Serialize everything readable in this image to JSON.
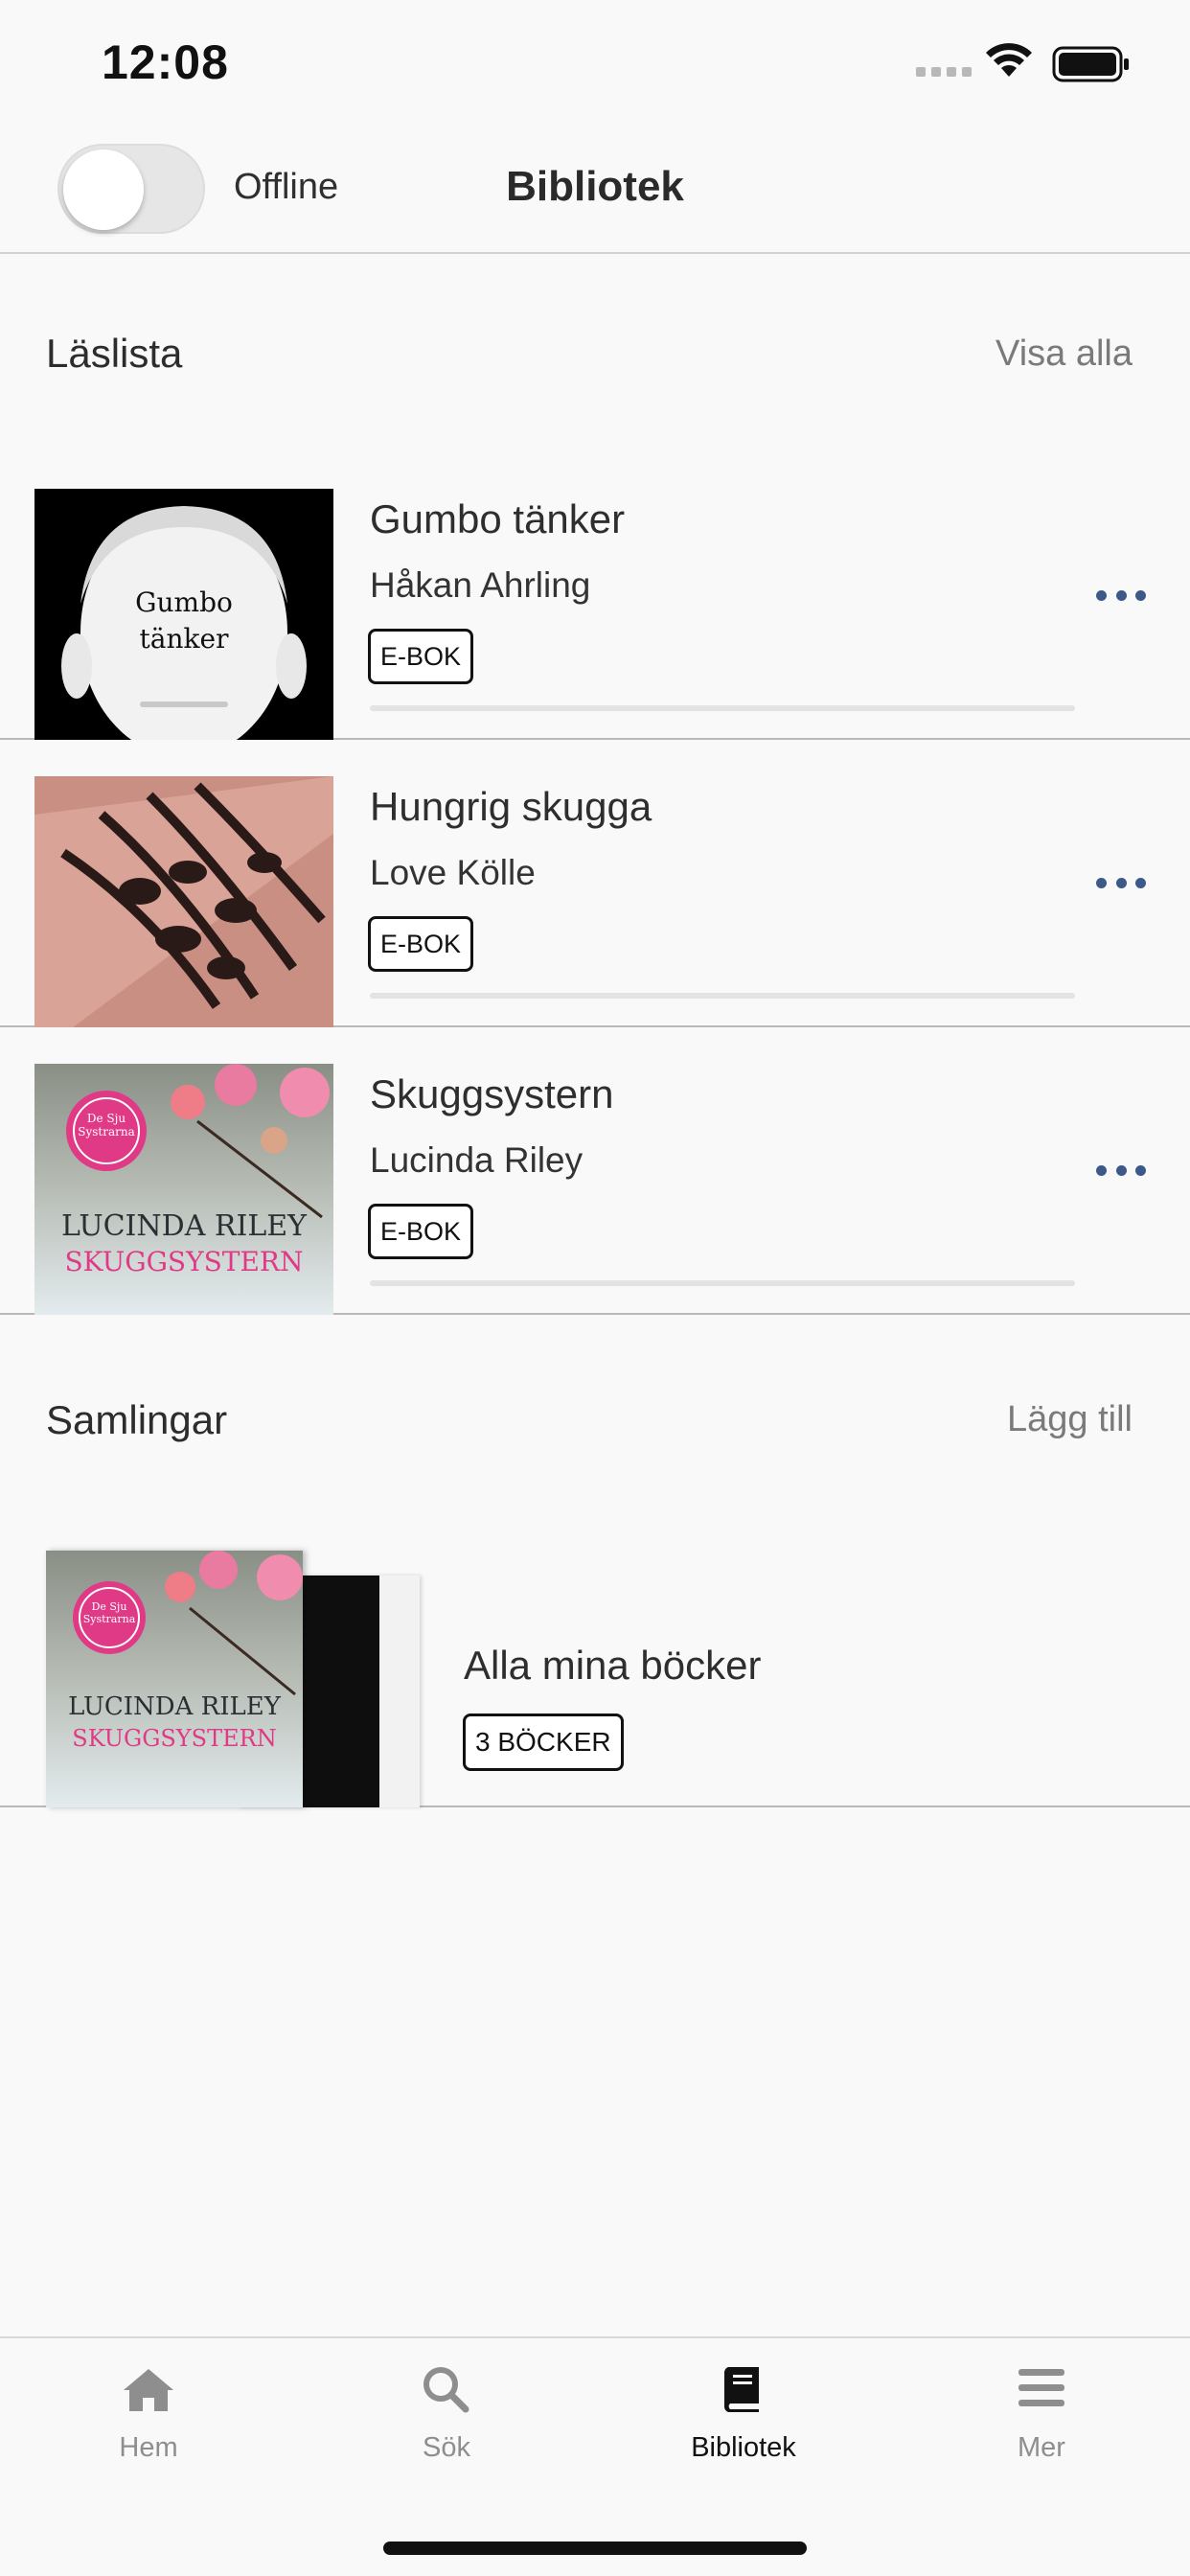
{
  "status_bar": {
    "time": "12:08"
  },
  "header": {
    "offline_label": "Offline",
    "title": "Bibliotek",
    "offline_enabled": false
  },
  "reading_list": {
    "title": "Läslista",
    "action": "Visa alla",
    "books": [
      {
        "title": "Gumbo tänker",
        "author": "Håkan Ahrling",
        "format": "E-BOK",
        "cover_text": "Gumbo tänker"
      },
      {
        "title": "Hungrig skugga",
        "author": "Love Kölle",
        "format": "E-BOK"
      },
      {
        "title": "Skuggsystern",
        "author": "Lucinda Riley",
        "format": "E-BOK",
        "cover_series": "De Sju Systrarna",
        "cover_author": "LUCINDA RILEY",
        "cover_title": "SKUGGSYSTERN"
      }
    ]
  },
  "collections": {
    "title": "Samlingar",
    "action": "Lägg till",
    "items": [
      {
        "title": "Alla mina böcker",
        "count_label": "3 BÖCKER"
      }
    ]
  },
  "tab_bar": {
    "tabs": [
      {
        "label": "Hem",
        "icon": "home-icon",
        "active": false
      },
      {
        "label": "Sök",
        "icon": "search-icon",
        "active": false
      },
      {
        "label": "Bibliotek",
        "icon": "book-icon",
        "active": true
      },
      {
        "label": "Mer",
        "icon": "menu-icon",
        "active": false
      }
    ]
  },
  "colors": {
    "accent": "#3b5a8a",
    "background": "#f9f9f9",
    "divider": "#b9b9b9"
  }
}
